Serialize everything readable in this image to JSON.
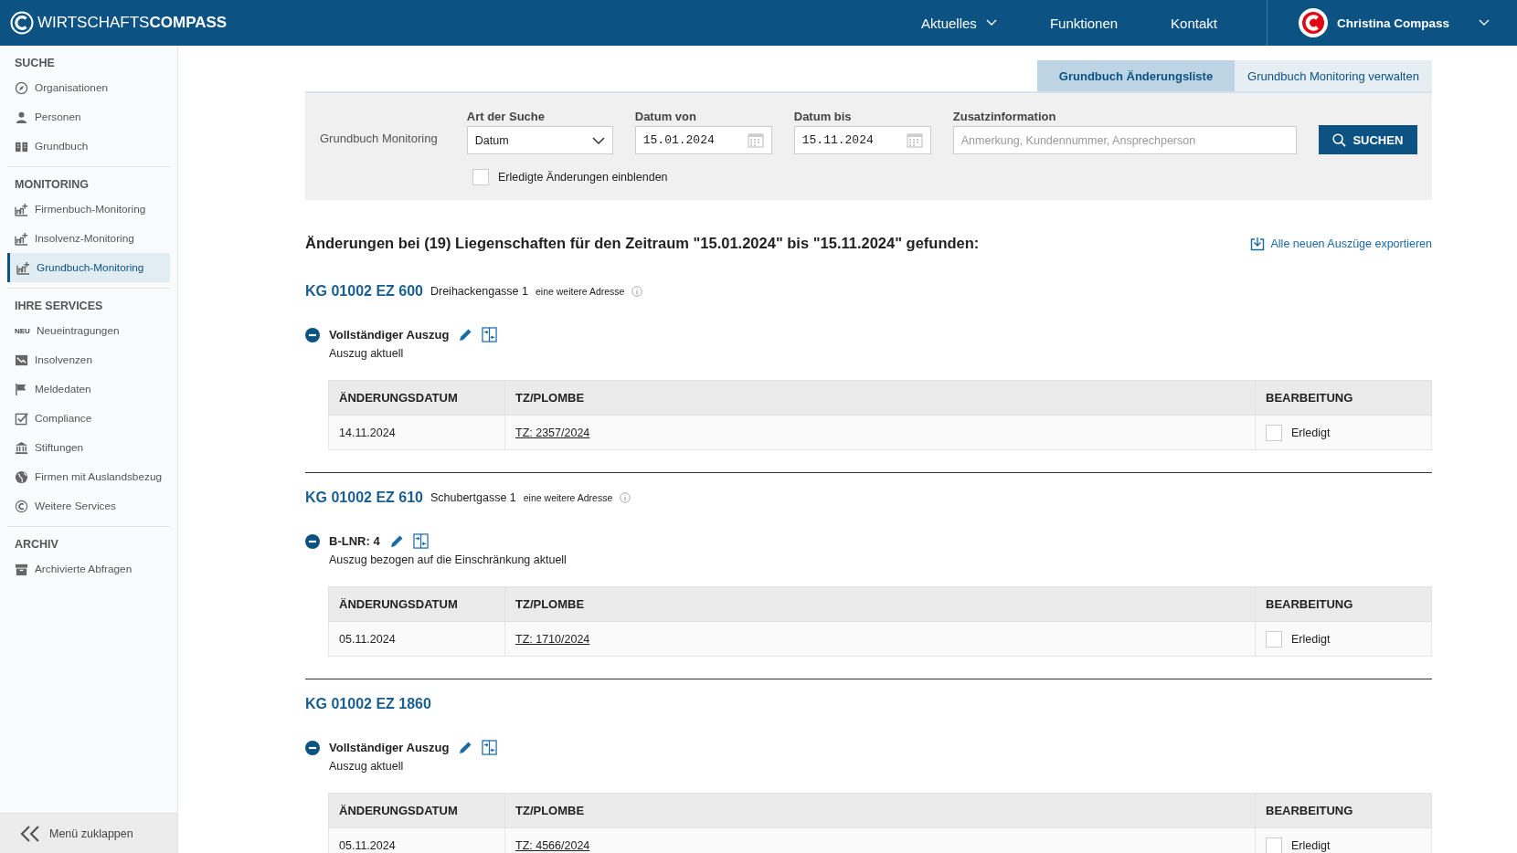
{
  "header": {
    "logo": {
      "prefix": "WIRTSCHAFTS",
      "brand": "COMPASS"
    },
    "nav": [
      {
        "label": "Aktuelles",
        "has_dropdown": true
      },
      {
        "label": "Funktionen",
        "has_dropdown": false
      },
      {
        "label": "Kontakt",
        "has_dropdown": false
      }
    ],
    "user": {
      "name": "Christina Compass"
    }
  },
  "sidebar": {
    "sections": [
      {
        "title": "SUCHE",
        "items": [
          {
            "label": "Organisationen",
            "selected": false
          },
          {
            "label": "Personen",
            "selected": false
          },
          {
            "label": "Grundbuch",
            "selected": false
          }
        ]
      },
      {
        "title": "MONITORING",
        "items": [
          {
            "label": "Firmenbuch-Monitoring",
            "selected": false
          },
          {
            "label": "Insolvenz-Monitoring",
            "selected": false
          },
          {
            "label": "Grundbuch-Monitoring",
            "selected": true
          }
        ]
      },
      {
        "title": "IHRE SERVICES",
        "items": [
          {
            "label": "Neueintragungen",
            "icon_text": "NEU",
            "selected": false
          },
          {
            "label": "Insolvenzen",
            "selected": false
          },
          {
            "label": "Meldedaten",
            "selected": false
          },
          {
            "label": "Compliance",
            "selected": false
          },
          {
            "label": "Stiftungen",
            "selected": false
          },
          {
            "label": "Firmen mit Auslandsbezug",
            "selected": false
          },
          {
            "label": "Weitere Services",
            "selected": false
          }
        ]
      },
      {
        "title": "ARCHIV",
        "items": [
          {
            "label": "Archivierte Abfragen",
            "selected": false
          }
        ]
      }
    ],
    "collapse": "Menü zuklappen"
  },
  "tabs": [
    {
      "label": "Grundbuch Änderungsliste",
      "selected": true
    },
    {
      "label": "Grundbuch Monitoring verwalten",
      "selected": false
    }
  ],
  "filter": {
    "label": "Grundbuch Monitoring",
    "fields": [
      {
        "kind": "select",
        "label": "Art der Suche",
        "value": "Datum"
      },
      {
        "kind": "date",
        "label": "Datum von",
        "value": "15.01.2024"
      },
      {
        "kind": "date",
        "label": "Datum bis",
        "value": "15.11.2024"
      },
      {
        "kind": "text",
        "label": "Zusatzinformation",
        "placeholder": "Anmerkung, Kundennummer, Ansprechperson"
      }
    ],
    "search_button": "SUCHEN",
    "show_done": {
      "label": "Erledigte Änderungen einblenden",
      "checked": false
    }
  },
  "results": {
    "heading": "Änderungen bei (19) Liegenschaften für den Zeitraum \"15.01.2024\" bis \"15.11.2024\" gefunden:",
    "export_link": "Alle neuen Auszüge exportieren"
  },
  "groups": [
    {
      "title": "KG 01002 EZ 600",
      "address": "Dreihackengasse 1",
      "more_address": "eine weitere Adresse",
      "extract": {
        "title": "Vollständiger Auszug",
        "subtitle": "Auszug aktuell",
        "expanded": true
      },
      "columns": [
        "ÄNDERUNGSDATUM",
        "TZ/PLOMBE",
        "BEARBEITUNG"
      ],
      "rows": [
        {
          "date": "14.11.2024",
          "tz": "TZ: 2357/2024",
          "status": "Erledigt",
          "done": false
        }
      ]
    },
    {
      "title": "KG 01002 EZ 610",
      "address": "Schubertgasse 1",
      "more_address": "eine weitere Adresse",
      "extract": {
        "title": "B-LNR: 4",
        "subtitle": "Auszug bezogen auf die Einschränkung aktuell",
        "expanded": true
      },
      "columns": [
        "ÄNDERUNGSDATUM",
        "TZ/PLOMBE",
        "BEARBEITUNG"
      ],
      "rows": [
        {
          "date": "05.11.2024",
          "tz": "TZ: 1710/2024",
          "status": "Erledigt",
          "done": false
        }
      ]
    },
    {
      "title": "KG 01002 EZ 1860",
      "extract": {
        "title": "Vollständiger Auszug",
        "subtitle": "Auszug aktuell",
        "expanded": true
      },
      "columns": [
        "ÄNDERUNGSDATUM",
        "TZ/PLOMBE",
        "BEARBEITUNG"
      ],
      "rows": [
        {
          "date": "05.11.2024",
          "tz": "TZ: 4566/2024",
          "status": "Erledigt",
          "done": false
        }
      ]
    }
  ]
}
